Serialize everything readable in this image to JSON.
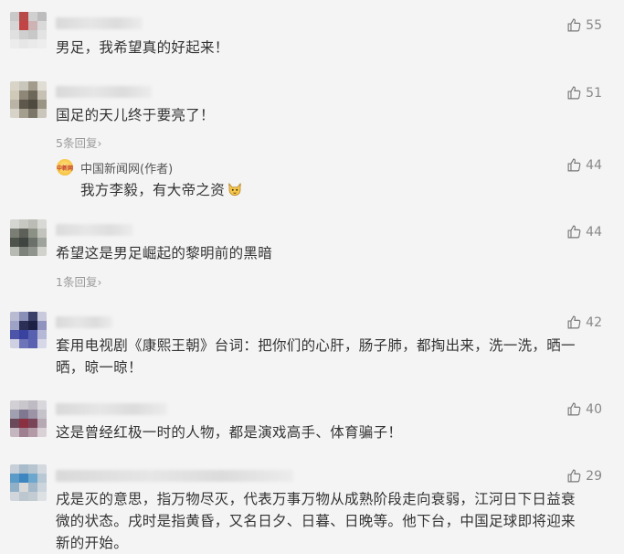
{
  "comments": [
    {
      "text": "男足，我希望真的好起来！",
      "likes": "55"
    },
    {
      "text": "国足的天儿终于要亮了！",
      "likes": "51",
      "replies": "5条回复›"
    },
    {
      "author_reply": {
        "name": "中国新闻网(作者)",
        "avatar_text": "中新网",
        "text": "我方李毅，有大帝之资",
        "likes": "44",
        "emoji": "cat-face-icon"
      }
    },
    {
      "text": "希望这是男足崛起的黎明前的黑暗",
      "likes": "44",
      "replies": "1条回复›",
      "name_partial": "行走 果告"
    },
    {
      "line1": "套用电视剧《康熙王朝》台词：把你们的心肝，肠子肺，都掏出来，洗一洗，晒一",
      "line2": "晒，晾一晾！",
      "likes": "42",
      "name_partial": "小川陳真"
    },
    {
      "text": "这是曾经红极一时的人物，都是演戏高手、体育骗子！",
      "likes": "40"
    },
    {
      "line1": "戌是灭的意思，指万物尽灭，代表万事万物从成熟阶段走向衰弱，江河日下日益衰",
      "line2": "微的状态。戌时是指黄昏，又名日夕、日暮、日晚等。他下台，中国足球即将迎来",
      "line3": "新的开始。",
      "likes": "29"
    }
  ],
  "colors": {
    "background": "#f4f4f4",
    "text": "#333333",
    "muted": "#9a9a9a",
    "like": "#888888"
  },
  "icons": {
    "like": "thumbs-up-icon"
  }
}
